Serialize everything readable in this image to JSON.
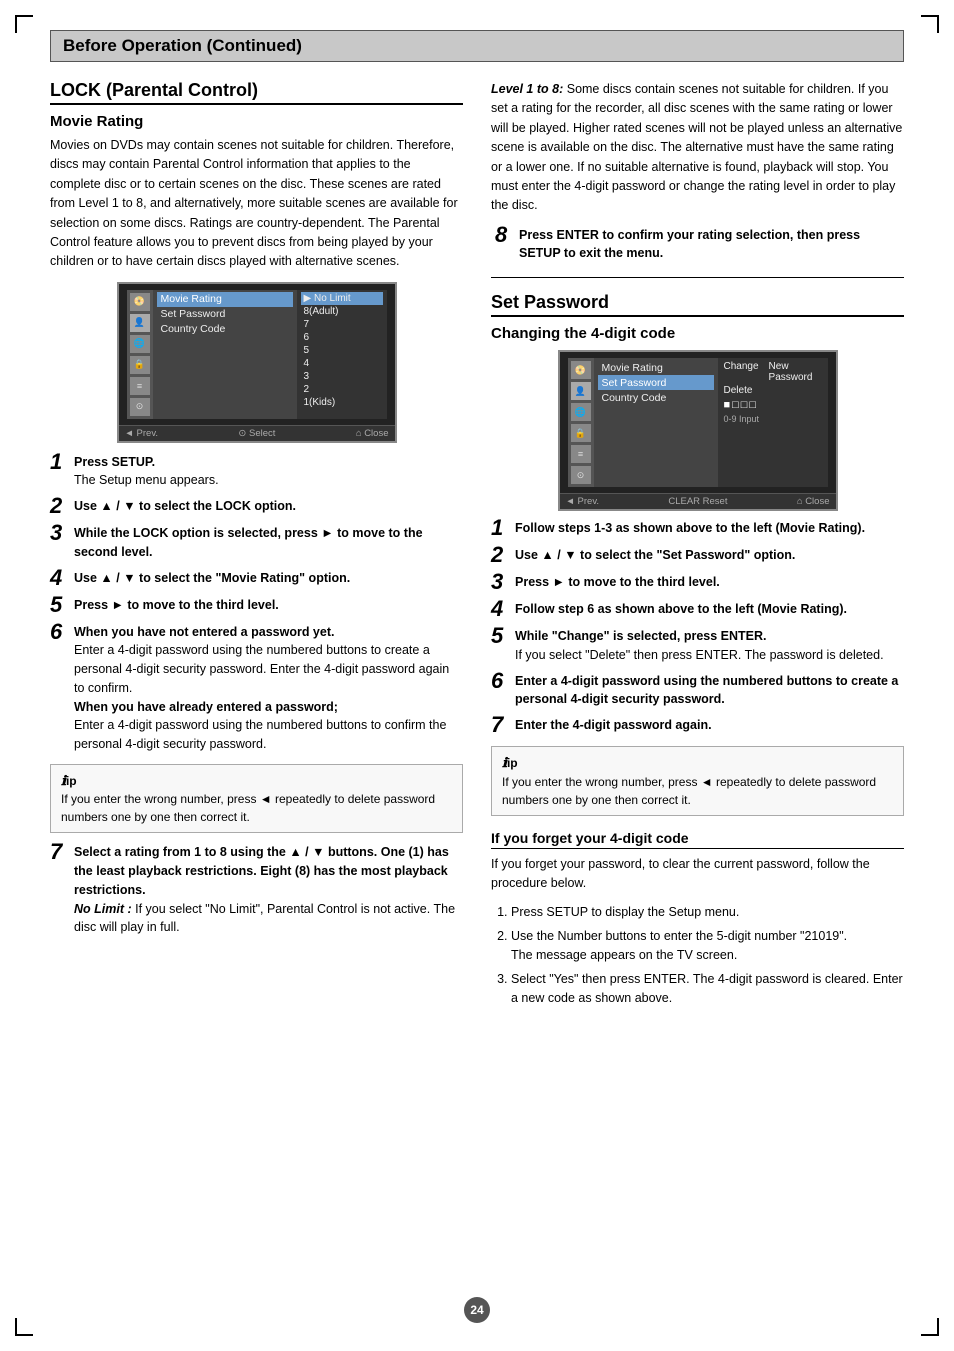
{
  "header": {
    "title": "Before Operation (Continued)"
  },
  "left_col": {
    "section_title": "LOCK (Parental Control)",
    "subsection_title": "Movie Rating",
    "intro_text": "Movies on DVDs may contain scenes not suitable for children. Therefore, discs may contain Parental Control information that applies to the complete disc or to certain scenes on the disc. These scenes are rated from Level 1 to 8, and alternatively, more suitable scenes are available for selection on some discs. Ratings are country-dependent. The Parental Control feature allows you to prevent discs from being played by your children or to have certain discs played with alternative scenes.",
    "menu": {
      "options": [
        "Movie Rating",
        "Set Password",
        "Country Code"
      ],
      "highlighted_option": "Movie Rating",
      "sub_items": [
        "No Limit",
        "8(Adult)",
        "7",
        "6",
        "5",
        "4",
        "3",
        "2",
        "1(Kids)"
      ],
      "highlighted_sub": "No Limit",
      "bottom_bar": [
        "◄ Prev.",
        "⊙ Select",
        "⌂ Close"
      ]
    },
    "steps": [
      {
        "num": "1",
        "bold": "Press SETUP.",
        "text": "The Setup menu appears."
      },
      {
        "num": "2",
        "bold": "Use ▲ / ▼ to select the LOCK option.",
        "text": ""
      },
      {
        "num": "3",
        "bold": "While the LOCK option is selected, press ► to move to the second level.",
        "text": ""
      },
      {
        "num": "4",
        "bold": "Use ▲ / ▼ to select the \"Movie Rating\" option.",
        "text": ""
      },
      {
        "num": "5",
        "bold": "Press ► to move to the third level.",
        "text": ""
      },
      {
        "num": "6",
        "bold_before": "When you have not entered a password yet.",
        "text_before": "Enter a 4-digit password using the numbered buttons to create a personal 4-digit security password. Enter the 4-digit password again to confirm.",
        "bold_after": "When you have already entered a password;",
        "text_after": "Enter a 4-digit password using the numbered buttons to confirm the personal 4-digit security password."
      }
    ],
    "tip": {
      "icon": "ℹ",
      "label": "ip",
      "text": "If you enter the wrong number, press ◄ repeatedly to delete password numbers one by one then correct it."
    },
    "step7": {
      "num": "7",
      "bold": "Select a rating from 1 to 8 using the ▲ / ▼ buttons. One (1) has the least playback restrictions. Eight (8) has the most playback restrictions.",
      "italic_label": "No Limit :",
      "italic_text": "If you select \"No Limit\", Parental Control is not active. The disc will play in full."
    }
  },
  "right_col": {
    "italic_intro_bold": "Level 1 to 8:",
    "italic_intro_text": " Some discs contain scenes not suitable for children. If you set a rating for the recorder, all disc scenes with the same rating or lower will be played. Higher rated scenes will not be played unless an alternative scene is available on the disc. The alternative must have the same rating or a lower one. If no suitable alternative is found, playback will stop. You must enter the 4-digit password or change the rating level in order to play the disc.",
    "step8": {
      "num": "8",
      "bold": "Press ENTER to confirm your rating selection, then press SETUP to exit the menu."
    },
    "set_password": {
      "section_title": "Set Password",
      "subsection_title": "Changing the 4-digit code",
      "menu": {
        "options": [
          "Movie Rating",
          "Set Password",
          "Country Code"
        ],
        "highlighted_option": "Set Password",
        "sub_items": [
          "Change",
          "Delete"
        ],
        "sub_col2_label": "New Password",
        "sub_col2_boxes": "■□□□",
        "sub_col2_input": "0-9 Input",
        "bottom_bar": [
          "◄ Prev.",
          "CLEAR Reset",
          "⌂ Close"
        ]
      },
      "steps": [
        {
          "num": "1",
          "bold": "Follow steps 1-3 as shown above to the left (Movie Rating)."
        },
        {
          "num": "2",
          "bold": "Use ▲ / ▼ to select the \"Set Password\" option."
        },
        {
          "num": "3",
          "bold": "Press ► to move to the third level."
        },
        {
          "num": "4",
          "bold": "Follow step 6 as shown above to the left (Movie Rating)."
        },
        {
          "num": "5",
          "bold": "While \"Change\" is selected, press ENTER.",
          "text": "If you select \"Delete\" then press ENTER. The password is deleted."
        },
        {
          "num": "6",
          "bold": "Enter a 4-digit password using the numbered buttons to create a personal 4-digit security password."
        },
        {
          "num": "7",
          "bold": "Enter the 4-digit password again."
        }
      ],
      "tip": {
        "icon": "ℹ",
        "label": "ip",
        "text": "If you enter the wrong number, press ◄ repeatedly to delete password numbers one by one then correct it."
      }
    },
    "forget": {
      "title": "If you forget your 4-digit code",
      "intro": "If you forget your password, to clear the current password, follow the procedure below.",
      "steps": [
        {
          "num": "1",
          "text": "Press SETUP to display the Setup menu."
        },
        {
          "num": "2",
          "text": "Use the Number buttons to enter the 5-digit number \"21019\".",
          "sub_text": "The message appears on the TV screen."
        },
        {
          "num": "3",
          "text": "Select \"Yes\" then press ENTER. The 4-digit password is cleared. Enter a new code as shown above."
        }
      ]
    }
  },
  "page_number": "24",
  "icons": [
    "disc-icon",
    "person-icon",
    "globe-icon",
    "lock-icon",
    "bars-icon",
    "circle-icon"
  ]
}
